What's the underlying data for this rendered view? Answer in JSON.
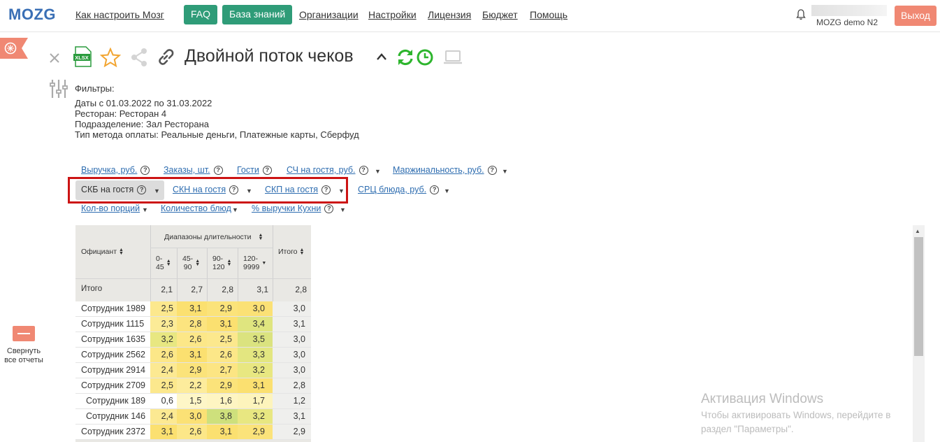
{
  "nav": {
    "logo": "MOZG",
    "links": [
      "Как настроить Мозг",
      "Организации",
      "Настройки",
      "Лицензия",
      "Бюджет",
      "Помощь"
    ],
    "faq": "FAQ",
    "kb": "База знаний",
    "user_name": "MOZG demo N2",
    "logout": "Выход"
  },
  "sidebar": {
    "collapse_line1": "Свернуть",
    "collapse_line2": "все отчеты"
  },
  "report": {
    "title": "Двойной поток чеков",
    "xlsx": "XLSX"
  },
  "filters": {
    "title": "Фильтры:",
    "dates_label": "Даты",
    "dates_value": "с 01.03.2022 по 31.03.2022",
    "restaurant_label": "Ресторан:",
    "restaurant_value": "Ресторан 4",
    "division_label": "Подразделение:",
    "division_value": "Зал Ресторана",
    "payment_label": "Тип метода оплаты:",
    "payment_value": "Реальные деньги, Платежные карты, Сберфуд"
  },
  "metrics": {
    "revenue": "Выручка, руб.",
    "orders": "Заказы, шт.",
    "guests": "Гости",
    "avg_check": "СЧ на гостя, руб.",
    "margin": "Маржинальность, руб.",
    "skb": "СКБ на гостя",
    "skn": "СКН на гостя",
    "skp": "СКП на гостя",
    "srts": "СРЦ блюда, руб.",
    "portions": "Кол-во порций",
    "dishes": "Количество блюд",
    "kitchen_share": "% выручки Кухни"
  },
  "table": {
    "col_waiter": "Официант",
    "col_ranges": "Диапазоны длительности",
    "col_total": "Итого",
    "range_labels": [
      [
        "0-",
        "45"
      ],
      [
        "45-",
        "90"
      ],
      [
        "90-",
        "120"
      ],
      [
        "120-",
        "9999"
      ]
    ],
    "totals_label": "Итого",
    "totals": [
      "2,1",
      "2,7",
      "2,8",
      "3,1",
      "2,8"
    ],
    "rows": [
      {
        "name": "Сотрудник 1989",
        "values": [
          "2,5",
          "3,1",
          "2,9",
          "3,0"
        ],
        "total": "3,0"
      },
      {
        "name": "Сотрудник 1115",
        "values": [
          "2,3",
          "2,8",
          "3,1",
          "3,4"
        ],
        "total": "3,1"
      },
      {
        "name": "Сотрудник 1635",
        "values": [
          "3,2",
          "2,6",
          "2,5",
          "3,5"
        ],
        "total": "3,0"
      },
      {
        "name": "Сотрудник 2562",
        "values": [
          "2,6",
          "3,1",
          "2,6",
          "3,3"
        ],
        "total": "3,0"
      },
      {
        "name": "Сотрудник 2914",
        "values": [
          "2,4",
          "2,9",
          "2,7",
          "3,2"
        ],
        "total": "3,0"
      },
      {
        "name": "Сотрудник 2709",
        "values": [
          "2,5",
          "2,2",
          "2,9",
          "3,1"
        ],
        "total": "2,8"
      },
      {
        "name": "Сотрудник 189",
        "values": [
          "0,6",
          "1,5",
          "1,6",
          "1,7"
        ],
        "total": "1,2"
      },
      {
        "name": "Сотрудник 146",
        "values": [
          "2,4",
          "3,0",
          "3,8",
          "3,2"
        ],
        "total": "3,1"
      },
      {
        "name": "Сотрудник 2372",
        "values": [
          "3,1",
          "2,6",
          "3,1",
          "2,9"
        ],
        "total": "2,9"
      }
    ]
  },
  "watermark": {
    "title": "Активация Windows",
    "line1": "Чтобы активировать Windows, перейдите в",
    "line2": "раздел \"Параметры\"."
  },
  "colors": {
    "brand_green": "#2f9c78",
    "logout": "#f08873",
    "link_blue": "#2e6db0",
    "highlight_red": "#cc1414"
  }
}
